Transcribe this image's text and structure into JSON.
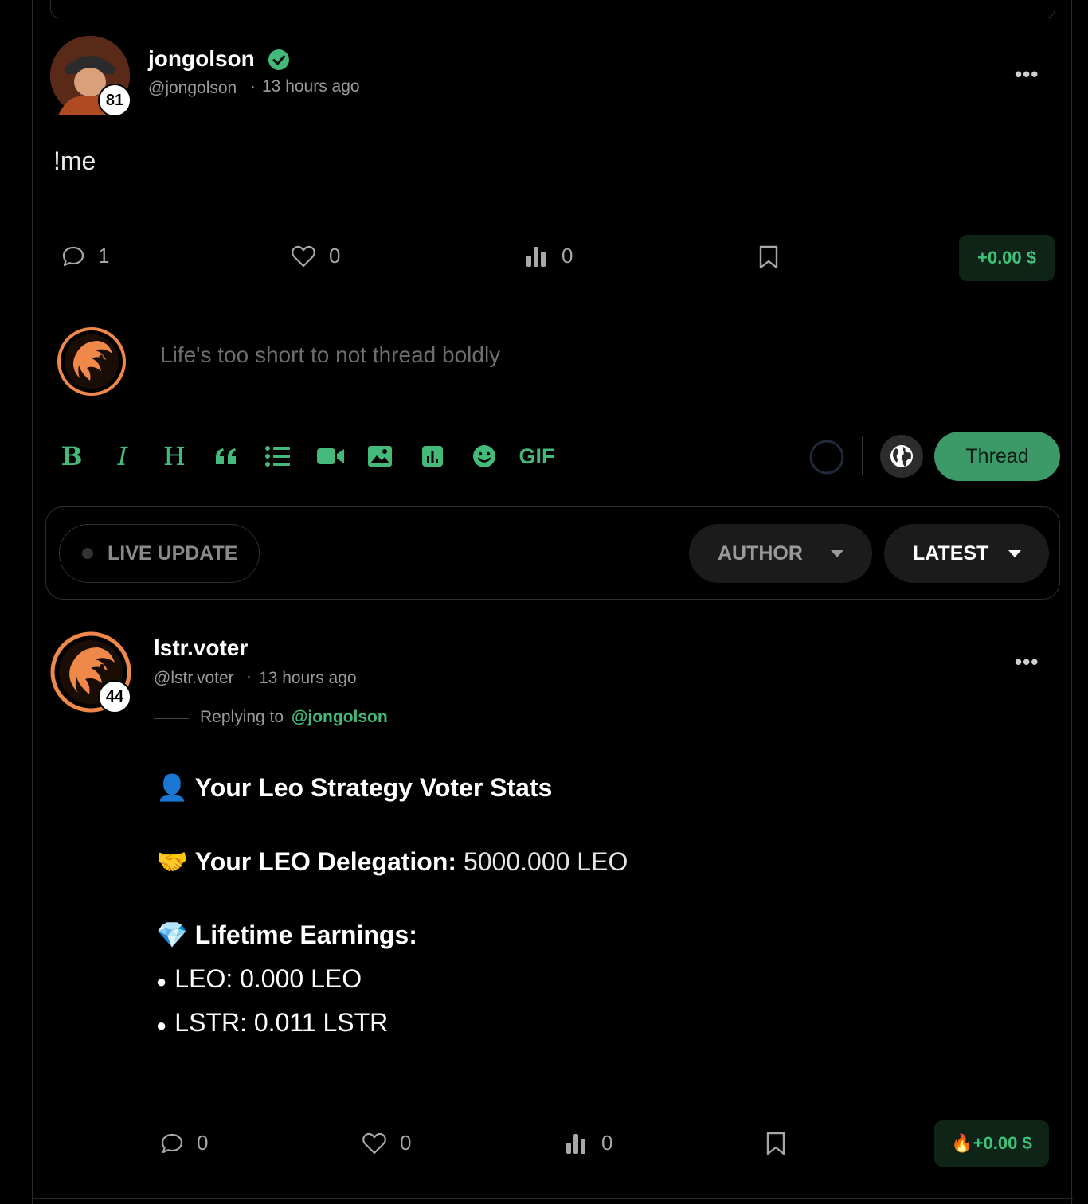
{
  "post1": {
    "display_name": "jongolson",
    "handle": "@jongolson",
    "time": "13 hours ago",
    "reputation": "81",
    "body": "!me",
    "comments": "1",
    "likes": "0",
    "views": "0",
    "earnings": "+0.00 $"
  },
  "composer": {
    "placeholder": "Life's too short to not thread boldly",
    "toolbar": [
      "B",
      "I",
      "H",
      "66",
      "list",
      "video",
      "image",
      "poll",
      "emoji",
      "GIF"
    ],
    "gif_label": "GIF",
    "submit_label": "Thread"
  },
  "filters": {
    "live_update": "LIVE UPDATE",
    "author": "AUTHOR",
    "sort": "LATEST"
  },
  "post2": {
    "display_name": "lstr.voter",
    "handle": "@lstr.voter",
    "time": "13 hours ago",
    "reputation": "44",
    "replying_label": "Replying to",
    "replying_to": "@jongolson",
    "heading_emoji": "👤",
    "heading": "Your Leo Strategy Voter Stats",
    "delegation_emoji": "🤝",
    "delegation_label": "Your LEO Delegation:",
    "delegation_value": "5000.000 LEO",
    "earnings_emoji": "💎",
    "earnings_label": "Lifetime Earnings:",
    "bullet_leo": "LEO: 0.000 LEO",
    "bullet_lstr": "LSTR: 0.011 LSTR",
    "comments": "0",
    "likes": "0",
    "views": "0",
    "earnings": "🔥+0.00 $"
  },
  "colors": {
    "accent": "#43b97a",
    "background": "#000000",
    "earn_bg": "#0e2417",
    "lion_orange": "#f0884a"
  }
}
